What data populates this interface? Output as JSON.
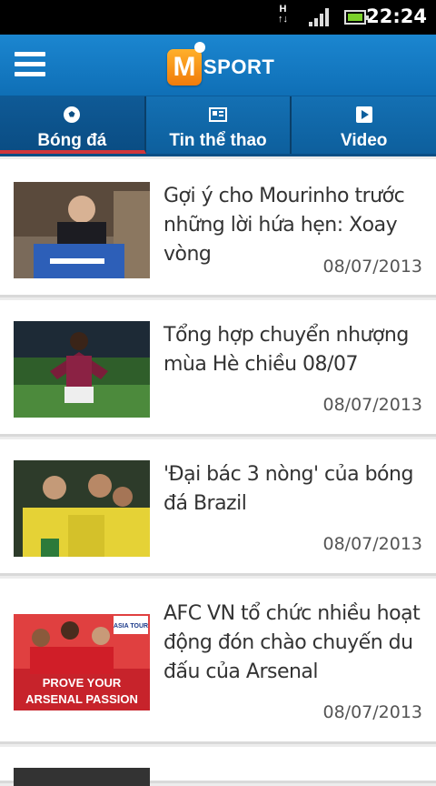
{
  "status_bar": {
    "time": "22:24",
    "network": "H"
  },
  "app": {
    "logo_letter": "M",
    "logo_text": "SPORT"
  },
  "tabs": [
    {
      "label": "Bóng đá",
      "icon": "soccer-ball-icon"
    },
    {
      "label": "Tin thể thao",
      "icon": "newspaper-icon"
    },
    {
      "label": "Video",
      "icon": "play-icon"
    }
  ],
  "articles": [
    {
      "title": "Gợi ý cho Mourinho trước những lời hứa hẹn: Xoay vòng",
      "date": "08/07/2013"
    },
    {
      "title": "Tổng hợp chuyển nhượng mùa Hè chiều 08/07",
      "date": "08/07/2013"
    },
    {
      "title": "'Đại bác 3 nòng' của bóng đá Brazil",
      "date": "08/07/2013"
    },
    {
      "title": "AFC VN tổ chức nhiều hoạt động đón chào chuyến du đấu của Arsenal",
      "date": "08/07/2013"
    }
  ],
  "thumb_text": {
    "line1": "PROVE YOUR",
    "line2": "ARSENAL PASSION",
    "badge": "ASIA TOUR"
  },
  "colors": {
    "primary": "#1b86d0",
    "accent": "#d1373b",
    "logo": "#f07b0a"
  }
}
